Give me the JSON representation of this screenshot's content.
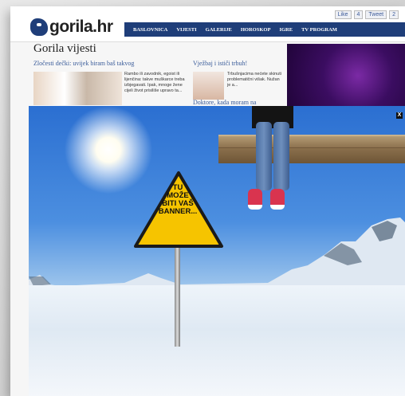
{
  "site": {
    "logo": "gorila.hr"
  },
  "social": {
    "like": "Like",
    "like_count": "4",
    "tweet": "Tweet",
    "tweet_count": "2"
  },
  "nav": {
    "items": [
      "BASLOVNICA",
      "VIJESTI",
      "GALERIJE",
      "HOROSKOP",
      "IGRE",
      "TV PROGRAM"
    ]
  },
  "section": {
    "title": "Gorila vijesti"
  },
  "articles": [
    {
      "title": "Zločesti dečki: uvijek biram baš takvog",
      "excerpt": "Rambo ili zavodnik, egoist ili lijenčina: takve muškarce treba izbjegavati. Ipak, mnoge žene cijeli život prisiliše upravo ta..."
    },
    {
      "title": "Vježbaj i ističi trbuh!",
      "excerpt": "Trbušnjacima nećete skinuti problematični višak. Nužan je a..."
    },
    {
      "title": "Doktore, kada moram na"
    }
  ],
  "banner": {
    "close": "X",
    "sign_lines": [
      "TU",
      "MOŽE",
      "BITI VAŠ",
      "BANNER..."
    ],
    "colors": {
      "sign": "#f6c400",
      "sky": "#2b6fd1",
      "shoes": "#d9344f"
    }
  }
}
